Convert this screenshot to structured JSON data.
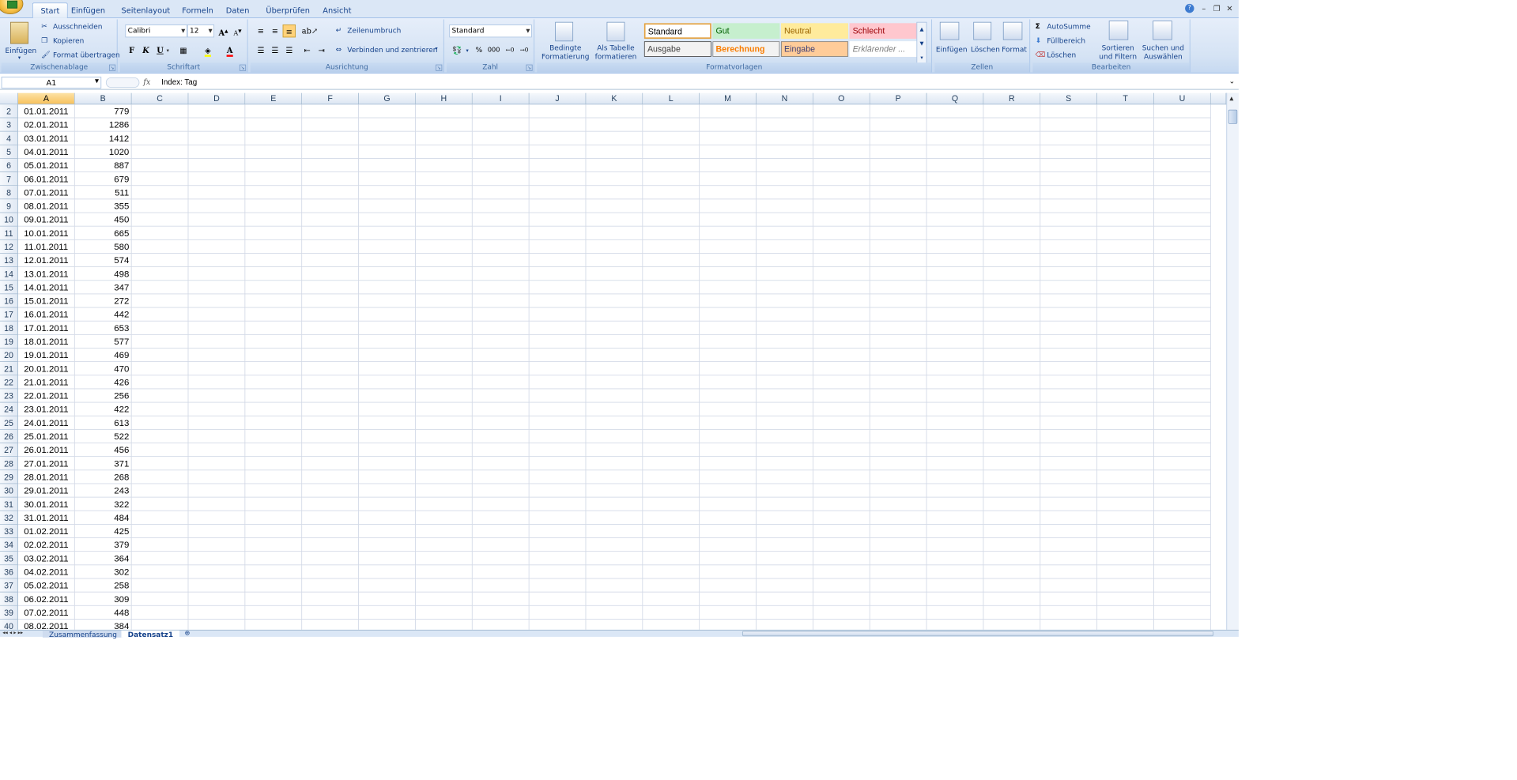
{
  "tabs": [
    "Start",
    "Einfügen",
    "Seitenlayout",
    "Formeln",
    "Daten",
    "Überprüfen",
    "Ansicht"
  ],
  "active_tab": "Start",
  "clipboard": {
    "paste": "Einfügen",
    "cut": "Ausschneiden",
    "copy": "Kopieren",
    "format_painter": "Format übertragen",
    "label": "Zwischenablage"
  },
  "font": {
    "name": "Calibri",
    "size": "12",
    "bold": "F",
    "italic": "K",
    "underline": "U",
    "grow": "A",
    "shrink": "A",
    "color_glyph": "A",
    "label": "Schriftart"
  },
  "alignment": {
    "wrap": "Zeilenumbruch",
    "merge": "Verbinden und zentrieren",
    "label": "Ausrichtung"
  },
  "number": {
    "format": "Standard",
    "percent": "%",
    "thousands": "000",
    "label": "Zahl"
  },
  "styles": {
    "conditional": "Bedingte\nFormatierung",
    "as_table": "Als Tabelle\nformatieren",
    "cells": [
      {
        "name": "Standard",
        "bg": "#ffffff",
        "fg": "#000000",
        "border": "#e3a03d"
      },
      {
        "name": "Gut",
        "bg": "#c6efce",
        "fg": "#006100",
        "border": "#c6efce"
      },
      {
        "name": "Neutral",
        "bg": "#ffeb9c",
        "fg": "#9c6500",
        "border": "#ffeb9c"
      },
      {
        "name": "Schlecht",
        "bg": "#ffc7ce",
        "fg": "#9c0006",
        "border": "#ffc7ce"
      },
      {
        "name": "Ausgabe",
        "bg": "#f2f2f2",
        "fg": "#3f3f3f",
        "border": "#3f3f3f"
      },
      {
        "name": "Berechnung",
        "bg": "#f2f2f2",
        "fg": "#fa7d00",
        "border": "#7f7f7f"
      },
      {
        "name": "Eingabe",
        "bg": "#ffcc99",
        "fg": "#3f3f76",
        "border": "#7f7f7f"
      },
      {
        "name": "Erklärender ...",
        "bg": "#ffffff",
        "fg": "#7f7f7f",
        "border": "#ffffff"
      }
    ],
    "label": "Formatvorlagen"
  },
  "cells_group": {
    "insert": "Einfügen",
    "delete": "Löschen",
    "format": "Format",
    "label": "Zellen"
  },
  "editing": {
    "autosum": "AutoSumme",
    "fill": "Füllbereich",
    "clear": "Löschen",
    "sort": "Sortieren\nund Filtern",
    "find": "Suchen und\nAuswählen",
    "label": "Bearbeiten"
  },
  "formula_bar": {
    "name_box": "A1",
    "fx": "fx",
    "content": "Index: Tag"
  },
  "columns": [
    "A",
    "B",
    "C",
    "D",
    "E",
    "F",
    "G",
    "H",
    "I",
    "J",
    "K",
    "L",
    "M",
    "N",
    "O",
    "P",
    "Q",
    "R",
    "S",
    "T",
    "U"
  ],
  "rows": [
    {
      "n": "2",
      "a": "01.01.2011",
      "b": "779"
    },
    {
      "n": "3",
      "a": "02.01.2011",
      "b": "1286"
    },
    {
      "n": "4",
      "a": "03.01.2011",
      "b": "1412"
    },
    {
      "n": "5",
      "a": "04.01.2011",
      "b": "1020"
    },
    {
      "n": "6",
      "a": "05.01.2011",
      "b": "887"
    },
    {
      "n": "7",
      "a": "06.01.2011",
      "b": "679"
    },
    {
      "n": "8",
      "a": "07.01.2011",
      "b": "511"
    },
    {
      "n": "9",
      "a": "08.01.2011",
      "b": "355"
    },
    {
      "n": "10",
      "a": "09.01.2011",
      "b": "450"
    },
    {
      "n": "11",
      "a": "10.01.2011",
      "b": "665"
    },
    {
      "n": "12",
      "a": "11.01.2011",
      "b": "580"
    },
    {
      "n": "13",
      "a": "12.01.2011",
      "b": "574"
    },
    {
      "n": "14",
      "a": "13.01.2011",
      "b": "498"
    },
    {
      "n": "15",
      "a": "14.01.2011",
      "b": "347"
    },
    {
      "n": "16",
      "a": "15.01.2011",
      "b": "272"
    },
    {
      "n": "17",
      "a": "16.01.2011",
      "b": "442"
    },
    {
      "n": "18",
      "a": "17.01.2011",
      "b": "653"
    },
    {
      "n": "19",
      "a": "18.01.2011",
      "b": "577"
    },
    {
      "n": "20",
      "a": "19.01.2011",
      "b": "469"
    },
    {
      "n": "21",
      "a": "20.01.2011",
      "b": "470"
    },
    {
      "n": "22",
      "a": "21.01.2011",
      "b": "426"
    },
    {
      "n": "23",
      "a": "22.01.2011",
      "b": "256"
    },
    {
      "n": "24",
      "a": "23.01.2011",
      "b": "422"
    },
    {
      "n": "25",
      "a": "24.01.2011",
      "b": "613"
    },
    {
      "n": "26",
      "a": "25.01.2011",
      "b": "522"
    },
    {
      "n": "27",
      "a": "26.01.2011",
      "b": "456"
    },
    {
      "n": "28",
      "a": "27.01.2011",
      "b": "371"
    },
    {
      "n": "29",
      "a": "28.01.2011",
      "b": "268"
    },
    {
      "n": "30",
      "a": "29.01.2011",
      "b": "243"
    },
    {
      "n": "31",
      "a": "30.01.2011",
      "b": "322"
    },
    {
      "n": "32",
      "a": "31.01.2011",
      "b": "484"
    },
    {
      "n": "33",
      "a": "01.02.2011",
      "b": "425"
    },
    {
      "n": "34",
      "a": "02.02.2011",
      "b": "379"
    },
    {
      "n": "35",
      "a": "03.02.2011",
      "b": "364"
    },
    {
      "n": "36",
      "a": "04.02.2011",
      "b": "302"
    },
    {
      "n": "37",
      "a": "05.02.2011",
      "b": "258"
    },
    {
      "n": "38",
      "a": "06.02.2011",
      "b": "309"
    },
    {
      "n": "39",
      "a": "07.02.2011",
      "b": "448"
    },
    {
      "n": "40",
      "a": "08.02.2011",
      "b": "384"
    }
  ],
  "sheets": [
    "Zusammenfassung",
    "Datensatz1"
  ],
  "active_sheet": "Datensatz1"
}
